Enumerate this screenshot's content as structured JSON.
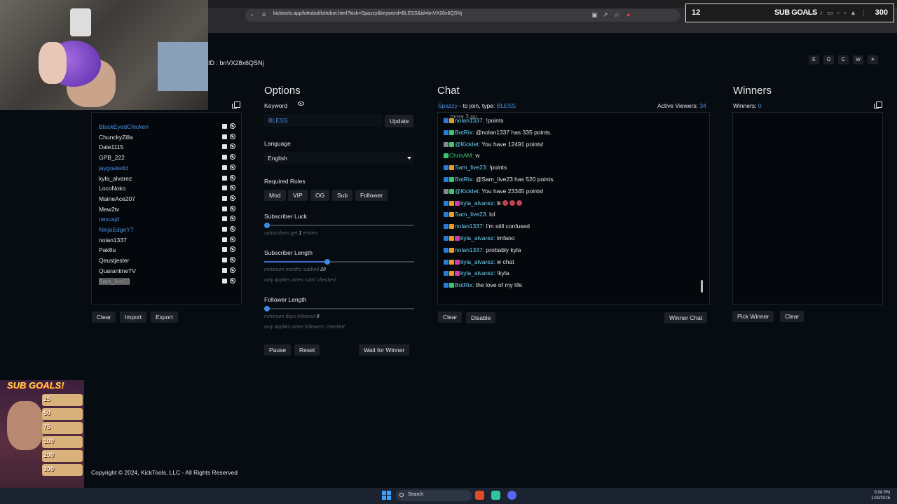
{
  "browser": {
    "url": "kicktools.app/lottobot/lottobot.html?kick=Spazzy&keyword=BLESS&id=bnVX28x6QSNj"
  },
  "goal_overlay": {
    "count": "12",
    "title": "SUB GOALS",
    "target": "300"
  },
  "page": {
    "id_label": "ID : bnVX28x6QSNj",
    "top_buttons": [
      "E",
      "O",
      "C",
      "W",
      "☀"
    ]
  },
  "participants": {
    "items": [
      {
        "name": "BlackEyedChicken",
        "style": "blue"
      },
      {
        "name": "ChunckyZilla",
        "style": "normal"
      },
      {
        "name": "Dale1115",
        "style": "normal"
      },
      {
        "name": "GPB_222",
        "style": "normal"
      },
      {
        "name": "jaygoatedd",
        "style": "blue"
      },
      {
        "name": "kyla_alvarez",
        "style": "normal"
      },
      {
        "name": "LocoNoko",
        "style": "normal"
      },
      {
        "name": "MaineAce207",
        "style": "normal"
      },
      {
        "name": "Mew2tv",
        "style": "normal"
      },
      {
        "name": "nexusjd",
        "style": "blue"
      },
      {
        "name": "NinjaEdgeYT",
        "style": "blue"
      },
      {
        "name": "nolan1337",
        "style": "normal"
      },
      {
        "name": "Pak8u",
        "style": "normal"
      },
      {
        "name": "Qeustjester",
        "style": "normal"
      },
      {
        "name": "QuarantineTV",
        "style": "normal"
      },
      {
        "name": "Sam_live23",
        "style": "selected"
      }
    ],
    "buttons": {
      "clear": "Clear",
      "import": "Import",
      "export": "Export"
    }
  },
  "options": {
    "title": "Options",
    "keyword_label": "Keyword",
    "keyword_value": "BLESS",
    "update_button": "Update",
    "language_label": "Language",
    "language_value": "English",
    "roles_label": "Required Roles",
    "roles": [
      "Mod",
      "VIP",
      "OG",
      "Sub",
      "Follower"
    ],
    "sub_luck_label": "Subscriber Luck",
    "sub_luck_hint_pre": "subscribers get",
    "sub_luck_value": "1",
    "sub_luck_hint_post": "entries",
    "sub_luck_level": 0.02,
    "sub_length_label": "Subscriber Length",
    "sub_length_hint_pre": "minimum months subbed",
    "sub_length_value": "20",
    "sub_length_note": "only applies when subs' checked",
    "sub_length_level": 0.42,
    "follower_label": "Follower Length",
    "follower_hint_pre": "minimum days followed",
    "follower_value": "0",
    "follower_note": "only applies when followers' checked",
    "follower_level": 0.02,
    "pause_button": "Pause",
    "reset_button": "Reset",
    "wait_button": "Wait for Winner"
  },
  "chat": {
    "title": "Chat",
    "channel": "Spazzy",
    "join_text": "- to join, type:",
    "keyword": "BLESS",
    "viewers_label": "Active Viewers:",
    "viewers_count": "34",
    "top_partial": "... more 3 go",
    "messages": [
      {
        "badges": [
          "mod",
          "sub"
        ],
        "user": "nolan1337",
        "user_color": "cyan",
        "text": "!points"
      },
      {
        "badges": [
          "mod",
          "bot"
        ],
        "user": "BotRix",
        "user_color": "cyan",
        "text": "@nolan1337 has 335 points."
      },
      {
        "badges": [
          "img",
          "bot"
        ],
        "user": "@Kicklet",
        "user_color": "cyan",
        "text": "You have 12491 points!"
      },
      {
        "badges": [
          "bot"
        ],
        "user": "ChrisAM",
        "user_color": "green",
        "text": "w"
      },
      {
        "badges": [
          "mod",
          "sub"
        ],
        "user": "Sam_live23",
        "user_color": "cyan",
        "text": "!points"
      },
      {
        "badges": [
          "mod",
          "bot"
        ],
        "user": "BotRix",
        "user_color": "cyan",
        "text": "@Sam_live23 has 520 points."
      },
      {
        "badges": [
          "img",
          "bot"
        ],
        "user": "@Kicklet",
        "user_color": "cyan",
        "text": "You have 23345 points!"
      },
      {
        "badges": [
          "mod",
          "gift",
          "vip"
        ],
        "user": "kyla_alvarez",
        "user_color": "cyan",
        "text": "ik",
        "emotes": 3
      },
      {
        "badges": [
          "mod",
          "sub"
        ],
        "user": "Sam_live23",
        "user_color": "cyan",
        "text": "lol"
      },
      {
        "badges": [
          "mod",
          "sub"
        ],
        "user": "nolan1337",
        "user_color": "cyan",
        "text": "I'm still confused"
      },
      {
        "badges": [
          "mod",
          "gift",
          "vip"
        ],
        "user": "kyla_alvarez",
        "user_color": "cyan",
        "text": "lmfaoo"
      },
      {
        "badges": [
          "mod",
          "sub"
        ],
        "user": "nolan1337",
        "user_color": "cyan",
        "text": "probably kyla"
      },
      {
        "badges": [
          "mod",
          "gift",
          "vip"
        ],
        "user": "kyla_alvarez",
        "user_color": "cyan",
        "text": "w chat"
      },
      {
        "badges": [
          "mod",
          "gift",
          "vip"
        ],
        "user": "kyla_alvarez",
        "user_color": "cyan",
        "text": "!kyla"
      },
      {
        "badges": [
          "mod",
          "bot"
        ],
        "user": "BotRix",
        "user_color": "cyan",
        "text": "the love of my life"
      }
    ],
    "clear_button": "Clear",
    "disable_button": "Disable",
    "winner_chat_button": "Winner Chat"
  },
  "winners": {
    "title": "Winners",
    "label": "Winners:",
    "count": "0",
    "pick_button": "Pick Winner",
    "clear_button": "Clear"
  },
  "footer": {
    "text": "Copyright © 2024, KickTools, LLC - All Rights Reserved"
  },
  "subgoals_overlay": {
    "title": "SUB GOALS!",
    "tiers": [
      "25",
      "50",
      "75",
      "100",
      "200",
      "300"
    ]
  },
  "taskbar": {
    "search_placeholder": "Search",
    "time": "6:08 PM",
    "date": "1/19/2026"
  },
  "colors": {
    "accent_blue": "#4a90e2",
    "bg": "#070b12",
    "chat_user": "#6dd0f0"
  }
}
